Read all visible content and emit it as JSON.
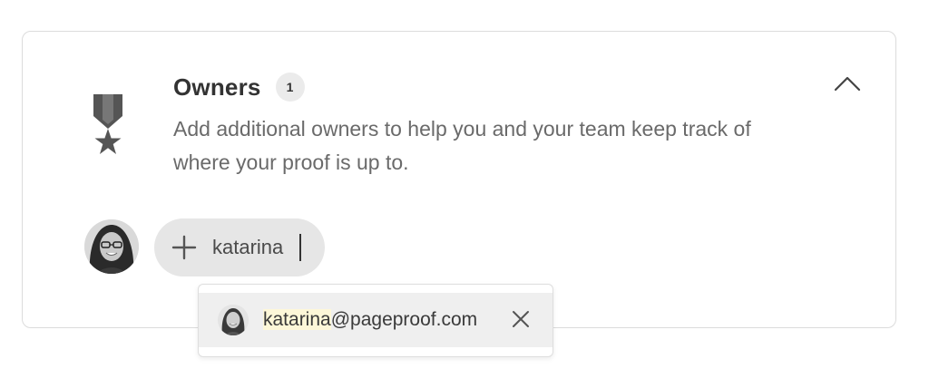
{
  "owners_section": {
    "title": "Owners",
    "count": "1",
    "description": "Add additional owners to help you and your team keep track of where your proof is up to.",
    "icon": "medal-icon",
    "collapse_icon": "chevron-up-icon"
  },
  "add_owner": {
    "icon": "plus-icon",
    "input_value": "katarina"
  },
  "suggestions": [
    {
      "match": "katarina",
      "rest": "@pageproof.com",
      "remove_icon": "close-icon"
    }
  ],
  "colors": {
    "match_highlight": "#fdf7d8",
    "pill_background": "#e6e6e6",
    "icon_gray": "#555555"
  }
}
